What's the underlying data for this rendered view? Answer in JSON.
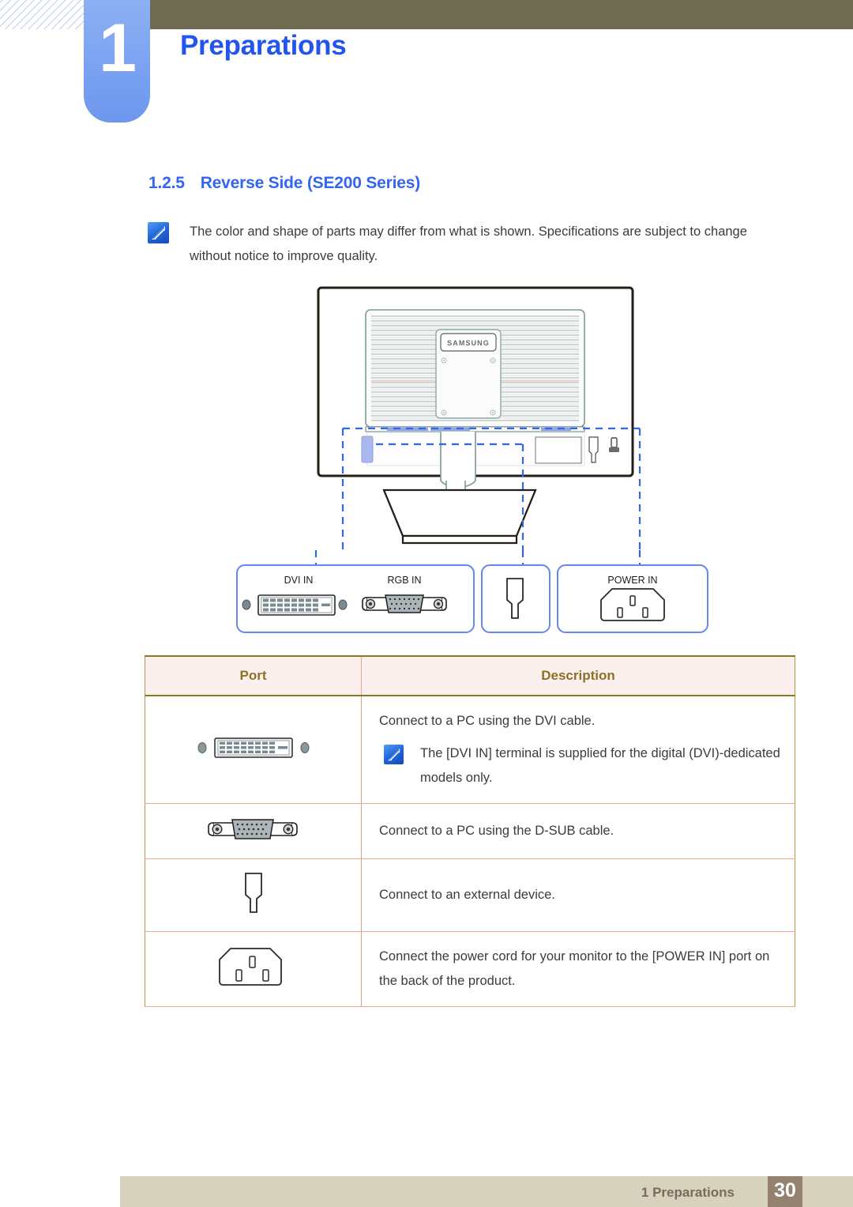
{
  "header": {
    "chapter_number": "1",
    "chapter_title": "Preparations",
    "bar_color": "#6e6b52",
    "tab_color": "#7ca3f1",
    "title_color": "#2255ee"
  },
  "section": {
    "number": "1.2.5",
    "title": "Reverse Side (SE200 Series)"
  },
  "note": {
    "icon": "note-pen-icon",
    "text": "The color and shape of parts may differ from what is shown. Specifications are subject to change without notice to improve quality."
  },
  "diagram": {
    "product_brand": "SAMSUNG",
    "callouts": [
      {
        "id": "callout-video-ports",
        "labels": [
          "DVI IN",
          "RGB IN"
        ],
        "icons": [
          "dvi-port-icon",
          "vga-port-icon"
        ]
      },
      {
        "id": "callout-external-device",
        "labels": [],
        "icons": [
          "audio-jack-icon"
        ]
      },
      {
        "id": "callout-power",
        "labels": [
          "POWER IN"
        ],
        "icons": [
          "power-socket-icon"
        ]
      }
    ],
    "dash_color": "#3366ee",
    "bezel_color": "#231f16",
    "vent_color": "#7d9a97",
    "lock_icon": "kensington-lock-icon"
  },
  "table": {
    "columns": [
      "Port",
      "Description"
    ],
    "header_text_color": "#8c7026",
    "header_bg_color": "#fcf0ef",
    "rows": [
      {
        "port_icon": "dvi-port-icon",
        "description": "Connect to a PC using the DVI cable.",
        "sub_note": {
          "icon": "note-pen-icon",
          "text": "The [DVI IN] terminal is supplied for the digital (DVI)-dedicated models only."
        }
      },
      {
        "port_icon": "vga-port-icon",
        "description": "Connect to a PC using the D-SUB cable.",
        "sub_note": null
      },
      {
        "port_icon": "audio-jack-icon",
        "description": "Connect to an external device.",
        "sub_note": null
      },
      {
        "port_icon": "power-socket-icon",
        "description": "Connect the power cord for your monitor to the [POWER IN] port on the back of the product.",
        "sub_note": null
      }
    ]
  },
  "footer": {
    "label": "1 Preparations",
    "page_number": "30",
    "bar_color": "#d7d2bd",
    "page_box_color": "#93826f"
  }
}
